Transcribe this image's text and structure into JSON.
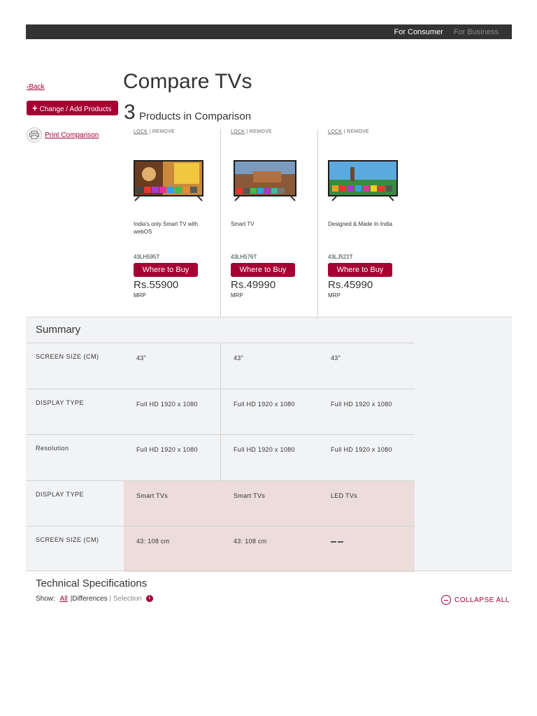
{
  "header": {
    "nav": [
      "For Consumer",
      "For Business"
    ]
  },
  "sidebar": {
    "back": "‹Back",
    "change_button": "Change / Add Products",
    "print": "Print Comparison"
  },
  "page": {
    "title": "Compare TVs",
    "count": "3",
    "count_label": "Products in Comparison"
  },
  "products": [
    {
      "lock": "LOCK",
      "remove": "REMOVE",
      "desc": "India's only Smart TV with webOS",
      "model": "43LH595T",
      "buy": "Where to Buy",
      "price": "Rs.55900",
      "mrp": "MRP"
    },
    {
      "lock": "LOCK",
      "remove": "REMOVE",
      "desc": "Smart TV",
      "model": "43LH576T",
      "buy": "Where to Buy",
      "price": "Rs.49990",
      "mrp": "MRP"
    },
    {
      "lock": "LOCK",
      "remove": "REMOVE",
      "desc": "Designed & Made In India",
      "model": "43LJ522T",
      "buy": "Where to Buy",
      "price": "Rs.45990",
      "mrp": "MRP"
    }
  ],
  "summary": {
    "title": "Summary",
    "rows": [
      {
        "label": "SCREEN SIZE (CM)",
        "values": [
          "43\"",
          "43\"",
          "43\""
        ]
      },
      {
        "label": "DISPLAY TYPE",
        "values": [
          "Full HD 1920 x 1080",
          "Full HD 1920 x 1080",
          "Full HD 1920 x 1080"
        ]
      },
      {
        "label": "Resolution",
        "values": [
          "Full HD 1920 x 1080",
          "Full HD 1920 x 1080",
          "Full HD 1920 x 1080"
        ]
      },
      {
        "label": "DISPLAY TYPE",
        "values": [
          "Smart TVs",
          "Smart TVs",
          "LED TVs"
        ]
      },
      {
        "label": "SCREEN SIZE (CM)",
        "values": [
          "43: 108 cm",
          "43: 108 cm",
          ""
        ]
      }
    ]
  },
  "tech": {
    "title": "Technical Specifications",
    "show": "Show:",
    "all": "All",
    "differences": "|Differences",
    "selection": "| Selection",
    "collapse": "COLLAPSE ALL"
  },
  "colors": {
    "accent": "#a50034",
    "topbar": "#333333",
    "panel": "#f2f3f5",
    "highlight": "#ecdcdc"
  }
}
